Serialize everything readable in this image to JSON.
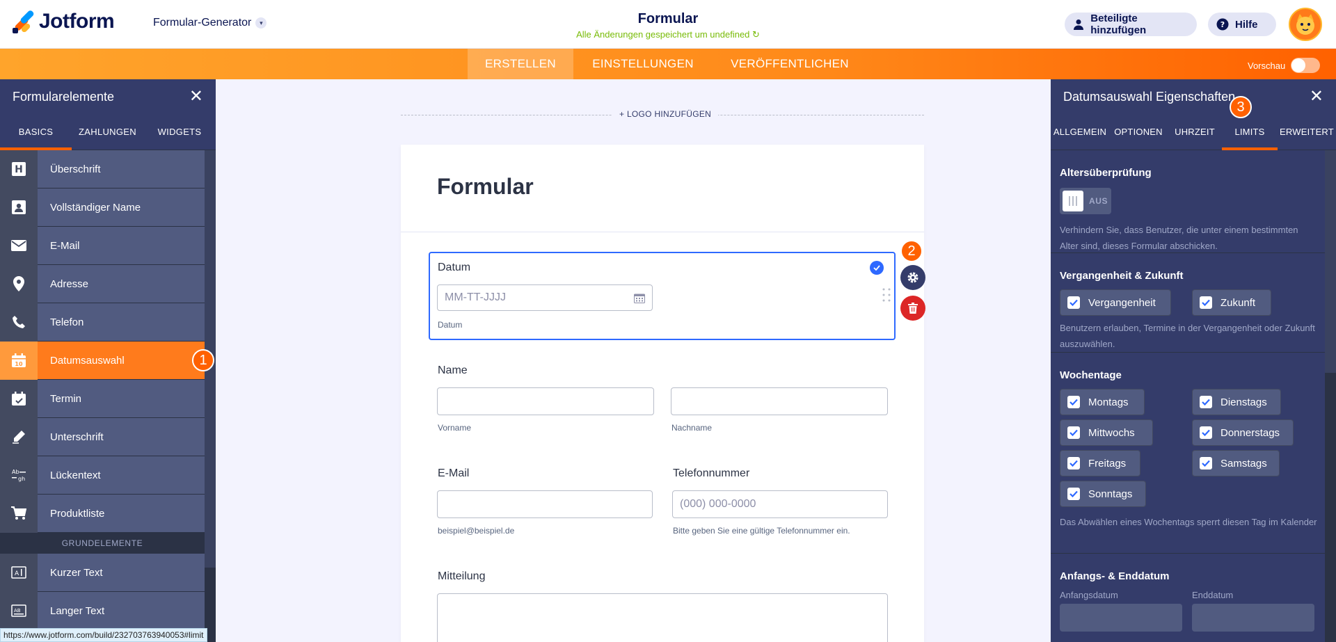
{
  "header": {
    "brand": "Jotform",
    "builder": "Formular-Generator",
    "form_title": "Formular",
    "save_status": "Alle Änderungen gespeichert um undefined",
    "invite_label": "Beteiligte hinzufügen",
    "help_label": "Hilfe"
  },
  "nav": {
    "tabs": [
      "ERSTELLEN",
      "EINSTELLUNGEN",
      "VERÖFFENTLICHEN"
    ],
    "active": "ERSTELLEN",
    "preview_label": "Vorschau"
  },
  "left_panel": {
    "title": "Formularelemente",
    "tabs": [
      "BASICS",
      "ZAHLUNGEN",
      "WIDGETS"
    ],
    "items": [
      {
        "label": "Überschrift",
        "icon": "heading-icon"
      },
      {
        "label": "Vollständiger Name",
        "icon": "contact-card-icon"
      },
      {
        "label": "E-Mail",
        "icon": "envelope-icon"
      },
      {
        "label": "Adresse",
        "icon": "map-pin-icon"
      },
      {
        "label": "Telefon",
        "icon": "phone-icon"
      },
      {
        "label": "Datumsauswahl",
        "icon": "calendar-icon"
      },
      {
        "label": "Termin",
        "icon": "calendar-check-icon"
      },
      {
        "label": "Unterschrift",
        "icon": "pen-icon"
      },
      {
        "label": "Lückentext",
        "icon": "fill-blank-icon"
      },
      {
        "label": "Produktliste",
        "icon": "cart-icon"
      }
    ],
    "section_label": "GRUNDELEMENTE",
    "basic_items": [
      {
        "label": "Kurzer Text",
        "icon": "short-text-icon"
      },
      {
        "label": "Langer Text",
        "icon": "long-text-icon"
      }
    ]
  },
  "badges": {
    "one": "1",
    "two": "2",
    "three": "3"
  },
  "canvas": {
    "logo_add": "+ LOGO HINZUFÜGEN",
    "title": "Formular",
    "date_field": {
      "label": "Datum",
      "placeholder": "MM-TT-JJJJ",
      "sublabel": "Datum"
    },
    "name_field": {
      "label": "Name",
      "first_sub": "Vorname",
      "last_sub": "Nachname"
    },
    "email_field": {
      "label": "E-Mail",
      "sublabel": "beispiel@beispiel.de"
    },
    "phone_field": {
      "label": "Telefonnummer",
      "placeholder": "(000) 000-0000",
      "sublabel": "Bitte geben Sie eine gültige Telefonnummer ein."
    },
    "message_field": {
      "label": "Mitteilung"
    }
  },
  "right_panel": {
    "title": "Datumsauswahl Eigenschaften",
    "tabs": [
      "ALLGEMEIN",
      "OPTIONEN",
      "UHRZEIT",
      "LIMITS",
      "ERWEITERT"
    ],
    "active_tab": "LIMITS",
    "age_check": {
      "title": "Altersüberprüfung",
      "toggle_label": "AUS",
      "enabled": false,
      "desc": "Verhindern Sie, dass Benutzer, die unter einem bestimmten Alter sind, dieses Formular abschicken."
    },
    "past_future": {
      "title": "Vergangenheit & Zukunft",
      "options": [
        {
          "label": "Vergangenheit",
          "checked": true
        },
        {
          "label": "Zukunft",
          "checked": true
        }
      ],
      "desc": "Benutzern erlauben, Termine in der Vergangenheit oder Zukunft auszuwählen."
    },
    "weekdays": {
      "title": "Wochentage",
      "options": [
        {
          "label": "Montags",
          "checked": true
        },
        {
          "label": "Dienstags",
          "checked": true
        },
        {
          "label": "Mittwochs",
          "checked": true
        },
        {
          "label": "Donnerstags",
          "checked": true
        },
        {
          "label": "Freitags",
          "checked": true
        },
        {
          "label": "Samstags",
          "checked": true
        },
        {
          "label": "Sonntags",
          "checked": true
        }
      ],
      "desc": "Das Abwählen eines Wochentags sperrt diesen Tag im Kalender"
    },
    "date_range": {
      "title": "Anfangs- & Enddatum",
      "start_label": "Anfangsdatum",
      "end_label": "Enddatum"
    }
  },
  "status_bar": {
    "url": "https://www.jotform.com/build/232703763940053#limit"
  },
  "colors": {
    "accent": "#ff6100",
    "panel": "#343c6a",
    "selection": "#2e69ff",
    "delete": "#dc2626"
  }
}
